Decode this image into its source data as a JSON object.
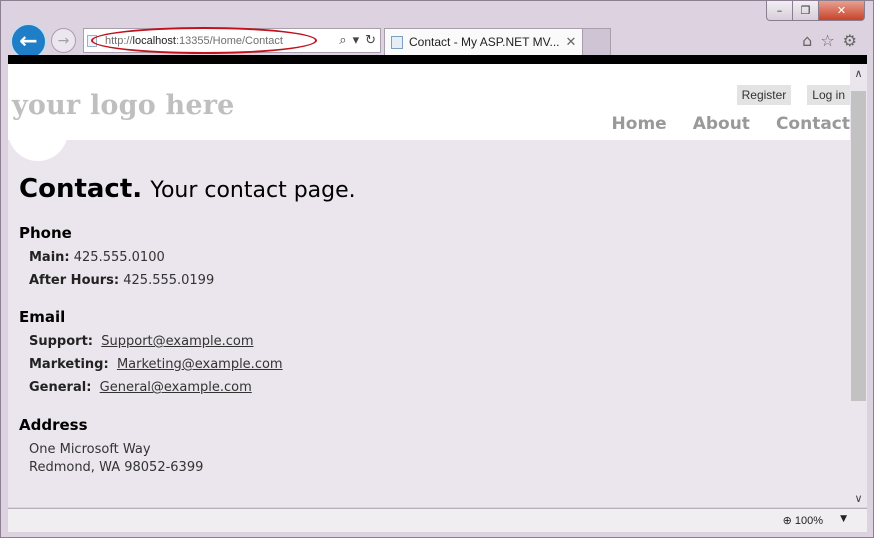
{
  "browser": {
    "url_prefix": "http://",
    "url_host": "localhost",
    "url_path": ":13355/Home/Contact",
    "tab_title": "Contact - My ASP.NET MV...",
    "zoom": "100%"
  },
  "site": {
    "logo": "your logo here",
    "register": "Register",
    "login": "Log in",
    "nav": [
      "Home",
      "About",
      "Contact"
    ]
  },
  "page": {
    "title_bold": "Contact.",
    "title_rest": "Your contact page.",
    "phone": {
      "heading": "Phone",
      "main_label": "Main:",
      "main_value": "425.555.0100",
      "after_label": "After Hours:",
      "after_value": "425.555.0199"
    },
    "email": {
      "heading": "Email",
      "support_label": "Support:",
      "support_value": "Support@example.com",
      "marketing_label": "Marketing:",
      "marketing_value": "Marketing@example.com",
      "general_label": "General:",
      "general_value": "General@example.com"
    },
    "address": {
      "heading": "Address",
      "line1": "One Microsoft Way",
      "line2": "Redmond, WA 98052-6399"
    }
  }
}
